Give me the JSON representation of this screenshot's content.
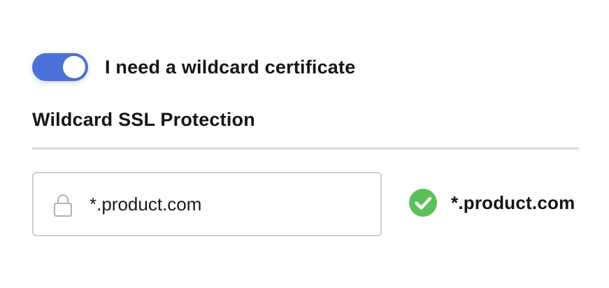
{
  "wildcard_toggle": {
    "label": "I need a wildcard certificate",
    "checked": true,
    "on_color": "#4a72d9"
  },
  "section": {
    "title": "Wildcard SSL Protection"
  },
  "domain_input": {
    "value": "*.product.com",
    "icon": "lock-icon"
  },
  "verified_domain": {
    "label": "*.product.com",
    "icon": "check-circle-icon",
    "status_color": "#5cc05a"
  }
}
